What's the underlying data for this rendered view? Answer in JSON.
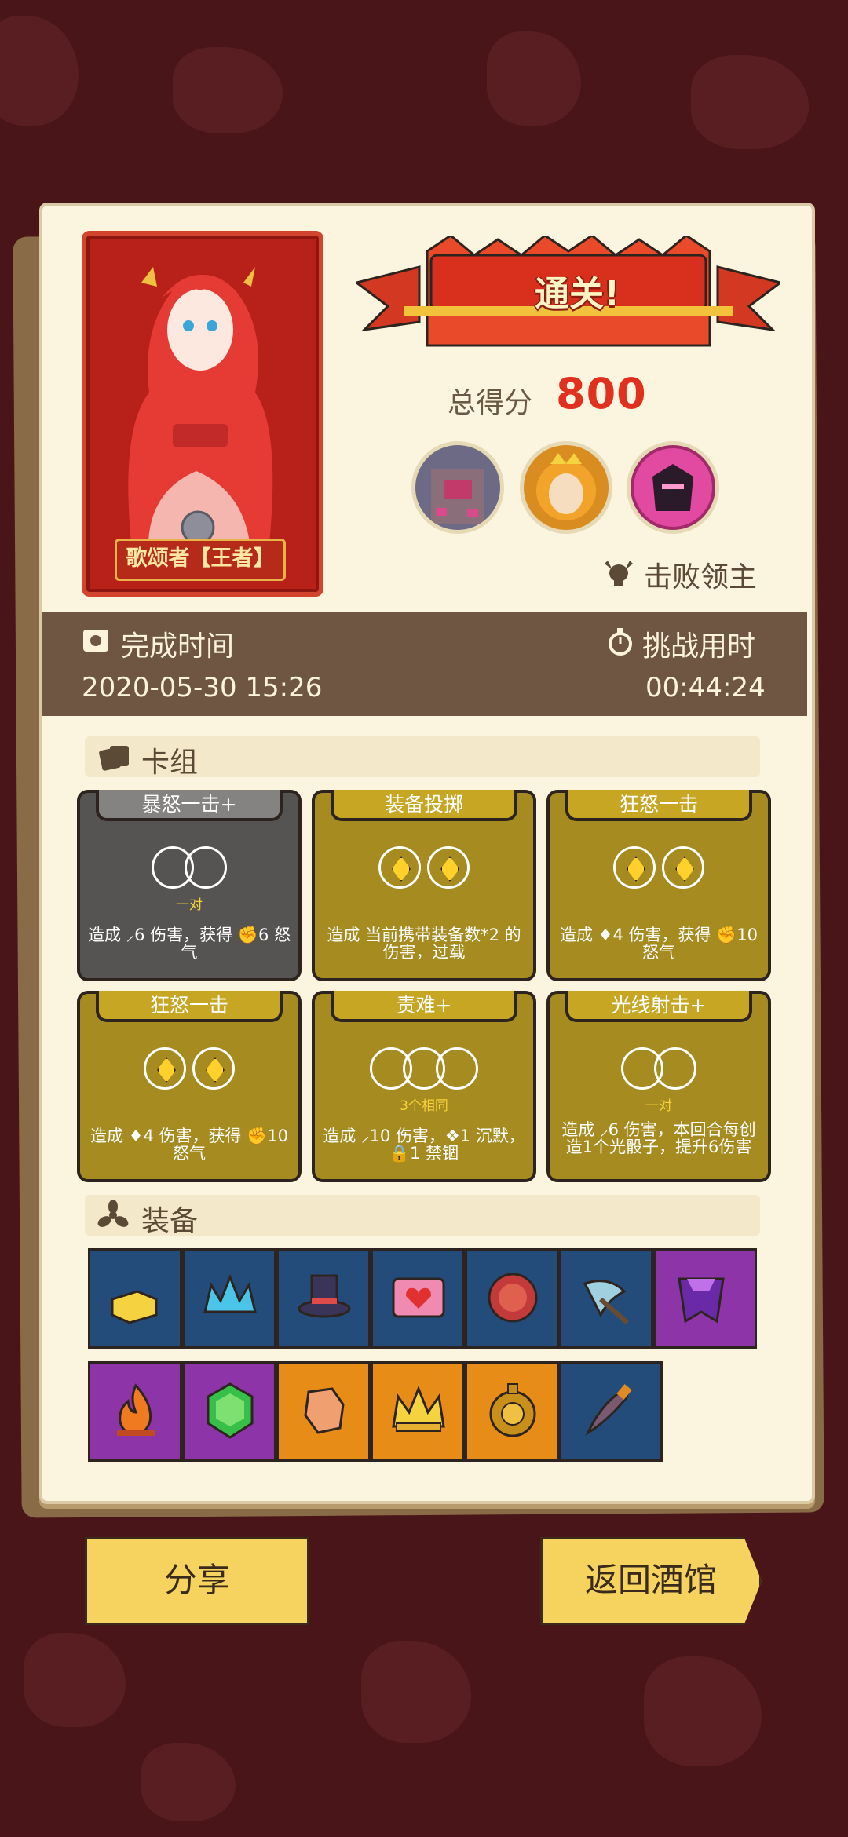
{
  "result": {
    "hero_name": "歌颂者【王者】",
    "banner": "通关!",
    "score_label": "总得分",
    "score_value": "800",
    "defeat_label": "击败领主"
  },
  "info": {
    "finish_label": "完成时间",
    "finish_value": "2020-05-30 15:26",
    "duration_label": "挑战用时",
    "duration_value": "00:44:24"
  },
  "deck": {
    "title": "卡组",
    "cards": [
      {
        "title": "暴怒一击+",
        "sub": "一对",
        "desc": "造成 ⸝6 伤害，获得 ✊6 怒气"
      },
      {
        "title": "装备投掷",
        "sub": "",
        "desc": "造成 当前携带装备数*2 的伤害，过载"
      },
      {
        "title": "狂怒一击",
        "sub": "",
        "desc": "造成 ♦4 伤害，获得 ✊10 怒气"
      },
      {
        "title": "狂怒一击",
        "sub": "",
        "desc": "造成 ♦4 伤害，获得 ✊10 怒气"
      },
      {
        "title": "责难+",
        "sub": "3个相同",
        "desc": "造成 ⸝10 伤害，❖1 沉默，🔒1 禁锢"
      },
      {
        "title": "光线射击+",
        "sub": "一对",
        "desc": "造成 ⸝6 伤害，本回合每创造1个光骰子，提升6伤害"
      }
    ]
  },
  "equipment": {
    "title": "装备",
    "items": [
      "gold-bars-icon",
      "ice-crown-icon",
      "top-hat-icon",
      "heart-box-icon",
      "shield-icon",
      "axe-icon",
      "purple-cloak-icon",
      "flame-icon",
      "emerald-icon",
      "glove-icon",
      "gold-crown-icon",
      "medallion-icon",
      "dagger-icon"
    ]
  },
  "buttons": {
    "share": "分享",
    "back": "返回酒馆"
  },
  "colors": {
    "background": "#4a1518",
    "panel": "#fbf4de",
    "info_bar": "#6e5642",
    "score": "#e2301e",
    "button": "#f6d35e"
  }
}
